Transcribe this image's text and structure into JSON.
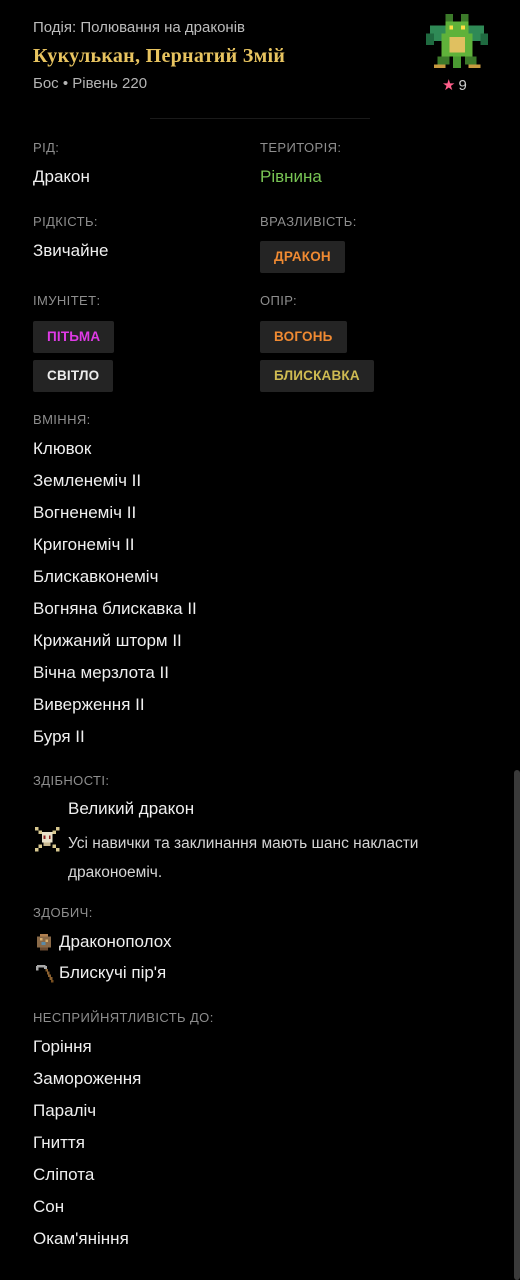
{
  "header": {
    "event": "Подія: Полювання на драконів",
    "name": "Кукулькан, Пернатий Змій",
    "meta": "Бос • Рівень 220",
    "stars": "9",
    "avatar_icon": "green-dragon-icon"
  },
  "stats": {
    "race_label": "РІД:",
    "race": "Дракон",
    "territory_label": "ТЕРИТОРІЯ:",
    "territory": "Рівнина",
    "rarity_label": "РІДКІСТЬ:",
    "rarity": "Звичайне",
    "weakness_label": "ВРАЗЛИВІСТЬ:",
    "weakness": [
      "ДРАКОН"
    ],
    "immunity_label": "ІМУНІТЕТ:",
    "immunity": [
      "ПІТЬМА",
      "СВІТЛО"
    ],
    "resistance_label": "ОПІР:",
    "resistance": [
      "ВОГОНЬ",
      "БЛИСКАВКА"
    ]
  },
  "skills": {
    "label": "ВМІННЯ:",
    "items": [
      "Клювок",
      "Земленеміч II",
      "Вогненеміч II",
      "Кригонеміч II",
      "Блискавконеміч",
      "Вогняна блискавка II",
      "Крижаний шторм II",
      "Вічна мерзлота II",
      "Виверження II",
      "Буря II"
    ]
  },
  "abilities": {
    "label": "ЗДІБНОСТІ:",
    "title": "Великий дракон",
    "description": "Усі навички та заклинання мають шанс накласти драконоеміч.",
    "icon": "dragon-skull-crossbones-icon"
  },
  "loot": {
    "label": "ЗДОБИЧ:",
    "items": [
      {
        "name": "Драконополох",
        "icon": "dragon-scale-icon"
      },
      {
        "name": "Блискучі пір'я",
        "icon": "pickaxe-icon"
      }
    ]
  },
  "immunities": {
    "label": "НЕСПРИЙНЯТЛИВІСТЬ ДО:",
    "items": [
      "Горіння",
      "Замороження",
      "Параліч",
      "Гниття",
      "Сліпота",
      "Сон",
      "Окам'яніння"
    ]
  },
  "colors": {
    "background": "#000000",
    "name_gold": "#e8c460",
    "territory_green": "#78c454",
    "badge_orange": "#f08a32",
    "badge_purple": "#df3ae6",
    "badge_yellow": "#cfbb52",
    "star_pink": "#ff5e8a"
  }
}
